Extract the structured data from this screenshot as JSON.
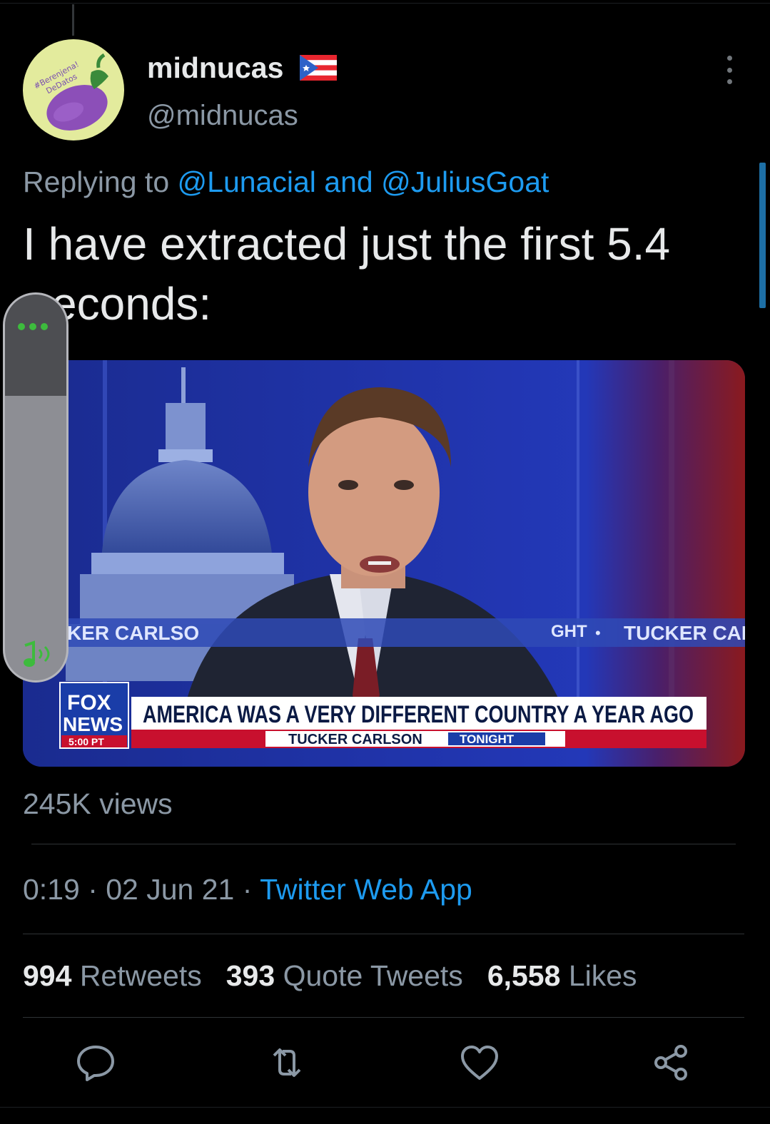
{
  "tweet": {
    "display_name": "midnucas",
    "handle": "@midnucas",
    "avatar": {
      "text_top": "#Berenjena!",
      "text_bottom": "DeDatos",
      "icon": "eggplant-icon"
    },
    "flag": "puerto-rico-flag-icon",
    "reply": {
      "prefix": "Replying to ",
      "user1": "@Lunacial",
      "sep": " and ",
      "user2": "@JuliusGoat"
    },
    "text_line1": "I have extracted just the first 5.4",
    "text_line2": "econds:",
    "views": "245K views",
    "time": "0:19",
    "date": "02 Jun 21",
    "source": "Twitter Web App",
    "stats": {
      "retweets_count": "994",
      "retweets_label": "Retweets",
      "quotes_count": "393",
      "quotes_label": "Quote Tweets",
      "likes_count": "6,558",
      "likes_label": "Likes"
    }
  },
  "media": {
    "ticker_left": "KER CARLSO",
    "ticker_right_fragment": "GHT",
    "ticker_right": "TUCKER CAR",
    "logo_line1": "FOX",
    "logo_line2": "NEWS",
    "logo_time": "5:00 PT",
    "headline": "AMERICA WAS A VERY DIFFERENT COUNTRY A YEAR AGO",
    "show_name": "TUCKER CARLSON",
    "show_suffix": "TONIGHT"
  },
  "colors": {
    "link": "#1d9bf0",
    "muted": "#8b98a5",
    "background": "#000000"
  },
  "icons": [
    "reply-icon",
    "retweet-icon",
    "like-icon",
    "share-icon",
    "more-icon",
    "music-note-icon"
  ]
}
